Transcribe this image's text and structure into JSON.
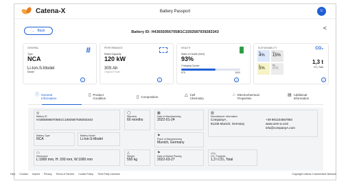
{
  "header": {
    "brand": "Catena-X",
    "title": "Battery Passport",
    "avatar": "☺"
  },
  "nav": {
    "back_label": "Back",
    "battery_id_label": "Battery ID: H436559567058I1C1592587939283343"
  },
  "general": {
    "label": "GENERAL",
    "type_label": "Type",
    "type_value": "NCA",
    "model_value": "Li-Ion-S-Model",
    "model_label": "Model",
    "icon": "#"
  },
  "performance": {
    "label": "PERFORMANCE",
    "rated_label": "Rated Capacity",
    "rated_value": "120 kW",
    "original_value": "30S Ah",
    "original_label": "Original Power"
  },
  "health": {
    "label": "HEALTH",
    "soh_label": "State of Health (SoH)",
    "soh_value": "93%",
    "cycles_label": "Charging Cycles",
    "cycles_current": "875",
    "cycles_max": "1500",
    "cycles_fraction": 0.58
  },
  "sustainability": {
    "label": "SUSTAINABILITY",
    "ni_label": "Ni",
    "ni_value": "4%",
    "co_label": "Co",
    "co_value": "15%",
    "li_label": "Li",
    "li_value": "5%",
    "pb_label": "Pb",
    "pb_value": "0%",
    "co2_label": "CO₂",
    "co2_value": "1,3 t",
    "co2_total_label": "CO₂ Total"
  },
  "tabs": [
    {
      "label": "General Information",
      "icon": "info-icon",
      "glyph": "ⓘ"
    },
    {
      "label": "Product Condition",
      "icon": "battery-icon",
      "glyph": "▯"
    },
    {
      "label": "Composition",
      "icon": "composition-icon",
      "glyph": "▯"
    },
    {
      "label": "Cell Chemistry",
      "icon": "chemistry-icon",
      "glyph": "△"
    },
    {
      "label": "Electrochemical Properties",
      "icon": "electro-icon",
      "glyph": "∴"
    },
    {
      "label": "Additional Information",
      "icon": "document-icon",
      "glyph": "▤"
    }
  ],
  "details": {
    "battery_id_label": "Battery ID",
    "battery_id_value": "H436559567058I1C1592587939283343",
    "warranty_label": "Warranty",
    "warranty_value": "60 months",
    "dom_label": "Date of Manufacturing",
    "dom_value": "2022-01-24",
    "manufacturer_label": "Manufacturer Information",
    "manufacturer_name": "CompanyA ,",
    "manufacturer_addr": "81345 Munich, Germany",
    "phone": "+49 891234567893",
    "web": "www.oem-a.com",
    "email": "info@companyA.com",
    "battery_type_label": "Battery Type",
    "battery_type_value": "NCA",
    "battery_model_label": "Battery Model",
    "battery_model_value": "Li-Ion-S-Model",
    "place_label": "Place of Manufacturing",
    "place_value": "Munich, Germany",
    "dimension_label": "Dimension",
    "dimension_value": "L:1800 mm, H: 200 mm, W:1000 mm",
    "weight_label": "Weight",
    "weight_value": "550 kg",
    "market_label": "Date of Market Placing",
    "market_value": "2022-03-27",
    "co2_label": "CO₂ Footprint",
    "co2_value": "1,3 t CO₂ Total"
  },
  "footer": {
    "links": [
      "Help",
      "Contact",
      "Imprint",
      "Privacy",
      "Terms of Service",
      "Cookie Policy",
      "Third Party Licenses"
    ],
    "copyright": "Copyright Catena-X Automotive Network"
  },
  "colors": {
    "accent": "#1f5fd6",
    "health_green": "#2e9e44",
    "ni_bg": "#dce8fb",
    "co_bg": "#e8e8e8",
    "li_bg": "#f7f3c6",
    "pb_bg": "#ececec"
  }
}
